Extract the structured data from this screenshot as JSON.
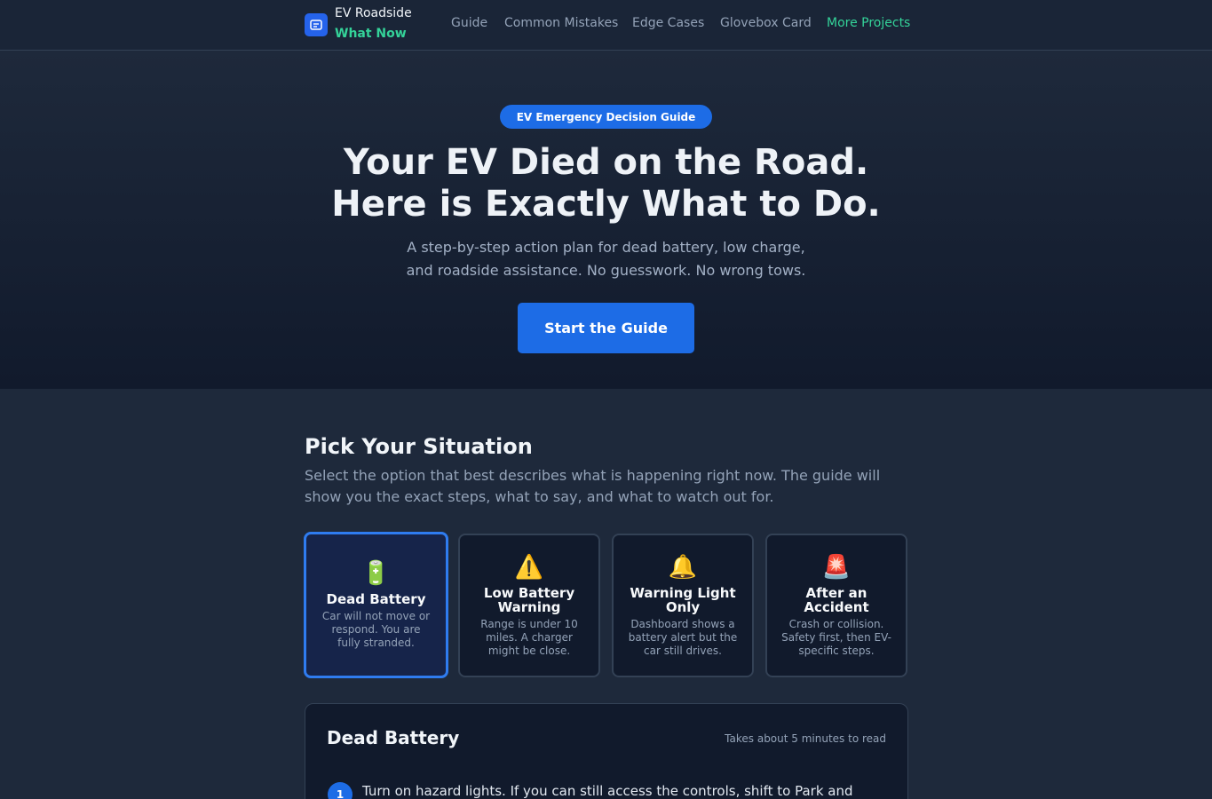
{
  "nav": {
    "brand_line1": "EV Roadside",
    "brand_line2": "What Now",
    "links": [
      "Guide",
      "Common Mistakes",
      "Edge Cases",
      "Glovebox Card",
      "More Projects"
    ]
  },
  "hero": {
    "badge": "EV Emergency Decision Guide",
    "title_line1": "Your EV Died on the Road.",
    "title_line2": "Here is Exactly What to Do.",
    "sub_line1": "A step-by-step action plan for dead battery, low charge,",
    "sub_line2": "and roadside assistance. No guesswork. No wrong tows.",
    "cta": "Start the Guide"
  },
  "situation": {
    "title": "Pick Your Situation",
    "desc": "Select the option that best describes what is happening right now. The guide will show you the exact steps, what to say, and what to watch out for.",
    "cards": [
      {
        "icon": "battery-icon",
        "glyph": "🔋",
        "title": "Dead Battery",
        "desc": "Car will not move or respond. You are fully stranded.",
        "selected": true
      },
      {
        "icon": "warning-icon",
        "glyph": "⚠️",
        "title": "Low Battery Warning",
        "desc": "Range is under 10 miles. A charger might be close.",
        "selected": false
      },
      {
        "icon": "bell-icon",
        "glyph": "🔔",
        "title": "Warning Light Only",
        "desc": "Dashboard shows a battery alert but the car still drives.",
        "selected": false
      },
      {
        "icon": "siren-icon",
        "glyph": "🚨",
        "title": "After an Accident",
        "desc": "Crash or collision. Safety first, then EV-specific steps.",
        "selected": false
      }
    ]
  },
  "panel": {
    "title": "Dead Battery",
    "meta": "Takes about 5 minutes to read",
    "step_number": "1",
    "step_text": "Turn on hazard lights. If you can still access the controls, shift to Park and"
  },
  "colors": {
    "accent_blue": "#1d6ce6",
    "accent_green": "#34d399",
    "background": "#1e293b"
  }
}
